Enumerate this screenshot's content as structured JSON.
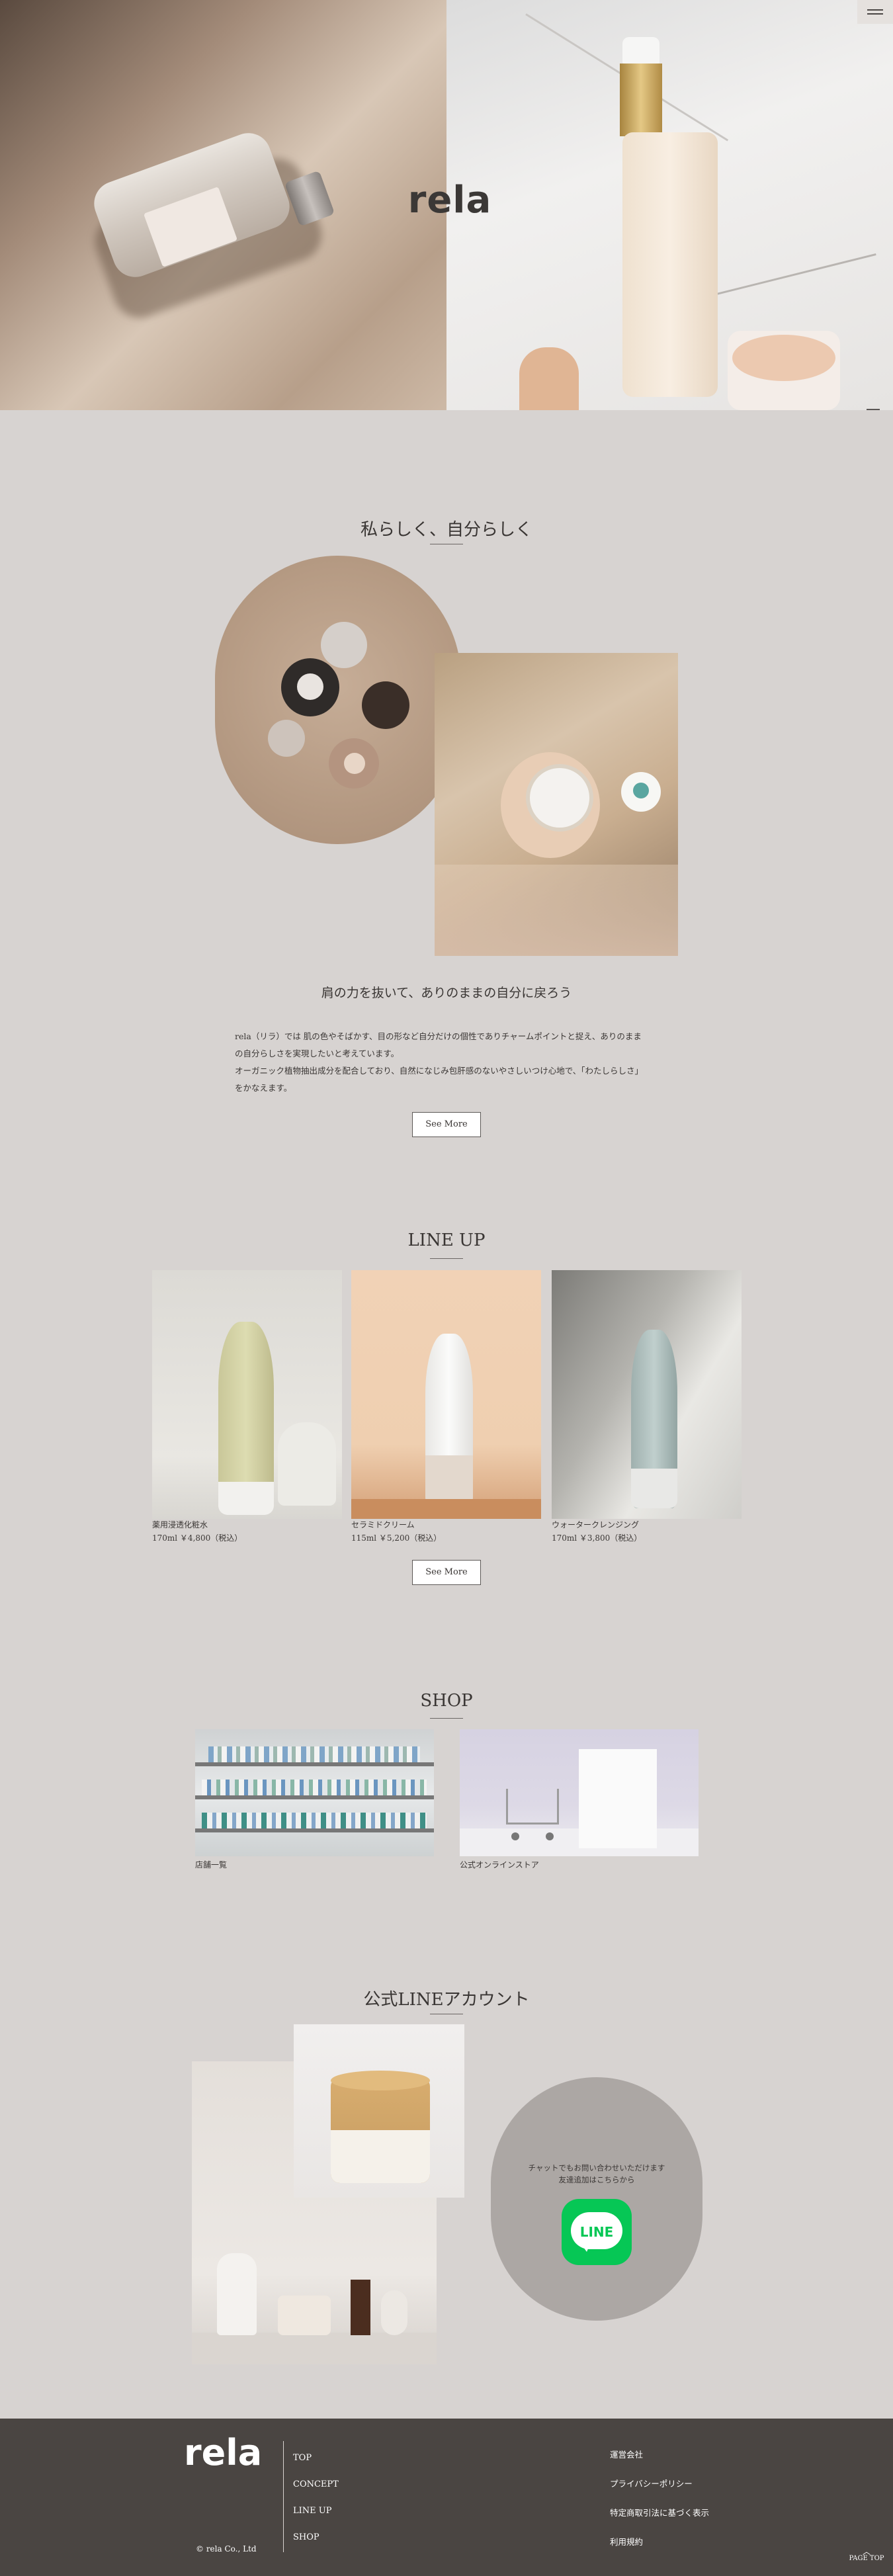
{
  "hero": {
    "logo": "rela"
  },
  "header": {
    "menu_icon": "hamburger-icon"
  },
  "concept": {
    "title": "私らしく、自分らしく",
    "subtitle": "肩の力を抜いて、ありのままの自分に戻ろう",
    "paragraph_lines": [
      "rela（リラ）では 肌の色やそばかす、目の形など自分だけの個性でありチャームポイントと捉え、ありのまま",
      "の自分らしさを実現したいと考えています。",
      "オーガニック植物抽出成分を配合しており、自然になじみ包肝感のないやさしいつけ心地で、「わたしらしさ」",
      "をかなえます。"
    ],
    "button": "See More"
  },
  "lineup": {
    "title": "LINE UP",
    "products": [
      {
        "name": "薬用浸透化粧水",
        "detail": "170ml ￥4,800（税込）"
      },
      {
        "name": "セラミドクリーム",
        "detail": "115ml ￥5,200（税込）"
      },
      {
        "name": "ウォータークレンジング",
        "detail": "170ml ￥3,800（税込）"
      }
    ],
    "button": "See More"
  },
  "shop": {
    "title": "SHOP",
    "items": [
      {
        "label": "店舗一覧"
      },
      {
        "label": "公式オンラインストア"
      }
    ]
  },
  "line": {
    "title": "公式LINEアカウント",
    "text_line1": "チャットでもお問い合わせいただけます",
    "text_line2": "友達追加はこちらから",
    "logo_word": "LINE"
  },
  "footer": {
    "logo": "rela",
    "nav": [
      "TOP",
      "CONCEPT",
      "LINE UP",
      "SHOP"
    ],
    "links": [
      "運営会社",
      "プライバシーポリシー",
      "特定商取引法に基づく表示",
      "利用規約"
    ],
    "copyright": "© rela Co., Ltd",
    "pagetop": "PAGE TOP"
  },
  "colors": {
    "background": "#d7d3d1",
    "footer": "#4a4542",
    "line_green": "#06c755"
  }
}
